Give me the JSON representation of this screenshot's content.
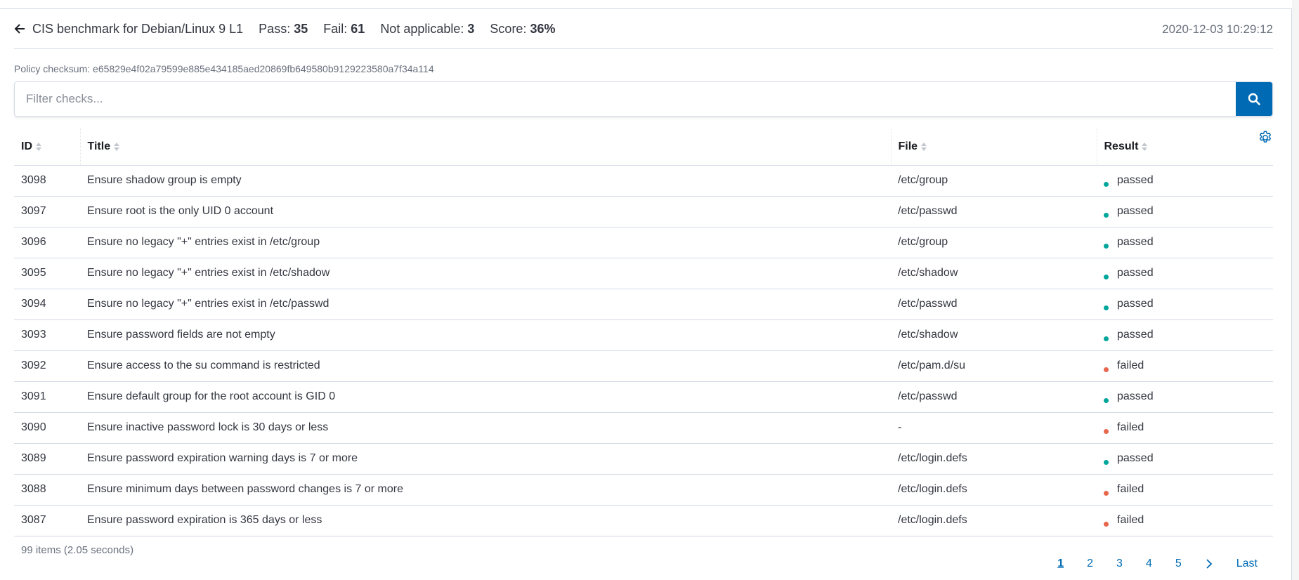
{
  "header": {
    "policy_name": "CIS benchmark for Debian/Linux 9 L1",
    "pass_label": "Pass:",
    "pass_value": "35",
    "fail_label": "Fail:",
    "fail_value": "61",
    "na_label": "Not applicable:",
    "na_value": "3",
    "score_label": "Score:",
    "score_value": "36%",
    "timestamp": "2020-12-03 10:29:12"
  },
  "checksum": "Policy checksum: e65829e4f02a79599e885e434185aed20869fb649580b9129223580a7f34a114",
  "search": {
    "placeholder": "Filter checks..."
  },
  "table": {
    "columns": [
      "ID",
      "Title",
      "File",
      "Result"
    ],
    "rows": [
      {
        "id": "3098",
        "title": "Ensure shadow group is empty",
        "file": "/etc/group",
        "result": "passed"
      },
      {
        "id": "3097",
        "title": "Ensure root is the only UID 0 account",
        "file": "/etc/passwd",
        "result": "passed"
      },
      {
        "id": "3096",
        "title": "Ensure no legacy \"+\" entries exist in /etc/group",
        "file": "/etc/group",
        "result": "passed"
      },
      {
        "id": "3095",
        "title": "Ensure no legacy \"+\" entries exist in /etc/shadow",
        "file": "/etc/shadow",
        "result": "passed"
      },
      {
        "id": "3094",
        "title": "Ensure no legacy \"+\" entries exist in /etc/passwd",
        "file": "/etc/passwd",
        "result": "passed"
      },
      {
        "id": "3093",
        "title": "Ensure password fields are not empty",
        "file": "/etc/shadow",
        "result": "passed"
      },
      {
        "id": "3092",
        "title": "Ensure access to the su command is restricted",
        "file": "/etc/pam.d/su",
        "result": "failed"
      },
      {
        "id": "3091",
        "title": "Ensure default group for the root account is GID 0",
        "file": "/etc/passwd",
        "result": "passed"
      },
      {
        "id": "3090",
        "title": "Ensure inactive password lock is 30 days or less",
        "file": "-",
        "result": "failed"
      },
      {
        "id": "3089",
        "title": "Ensure password expiration warning days is 7 or more",
        "file": "/etc/login.defs",
        "result": "passed"
      },
      {
        "id": "3088",
        "title": "Ensure minimum days between password changes is 7 or more",
        "file": "/etc/login.defs",
        "result": "failed"
      },
      {
        "id": "3087",
        "title": "Ensure password expiration is 365 days or less",
        "file": "/etc/login.defs",
        "result": "failed"
      }
    ]
  },
  "footer": {
    "items_count": "99 items (2.05 seconds)",
    "pages": [
      "1",
      "2",
      "3",
      "4",
      "5"
    ],
    "active_page": "1",
    "last_label": "Last"
  },
  "colors": {
    "passed": "#00a69b",
    "failed": "#e7664c",
    "accent": "#006bb4"
  }
}
